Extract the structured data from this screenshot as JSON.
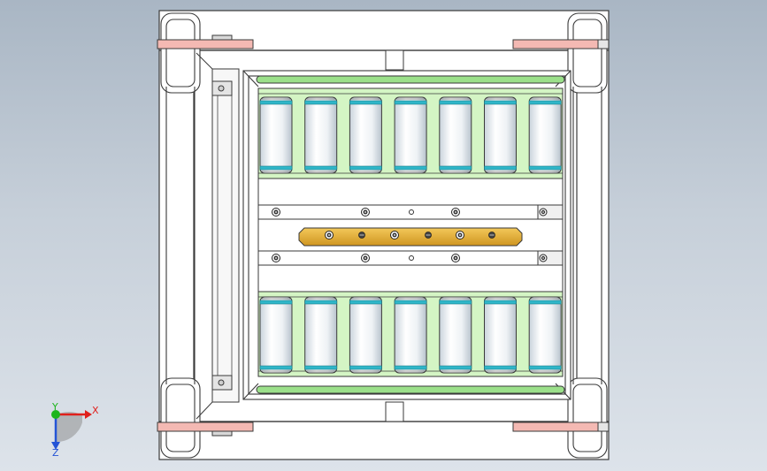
{
  "viewport": {
    "background_top": "#a9b6c4",
    "background_bottom": "#dde3ea"
  },
  "colors": {
    "frame_stroke": "#3a3a3a",
    "frame_fill": "#ffffff",
    "bracket": "#f4b9b3",
    "green_panel": "#d4f5c4",
    "green_rod": "#9be08a",
    "roller_body": "#f1f5f8",
    "roller_band": "#2fb6c9",
    "gold_bar": "#e3ae2e",
    "bolt": "#333333"
  },
  "triad": {
    "x_label": "X",
    "y_label": "Y",
    "z_label": "Z",
    "x_color": "#e0201c",
    "y_color": "#1db51d",
    "z_color": "#2454d6"
  },
  "rollers": {
    "top_row_count": 7,
    "bottom_row_count": 7
  },
  "icons": {
    "triad": "coordinate-triad-icon",
    "bolt": "hex-bolt-icon"
  }
}
